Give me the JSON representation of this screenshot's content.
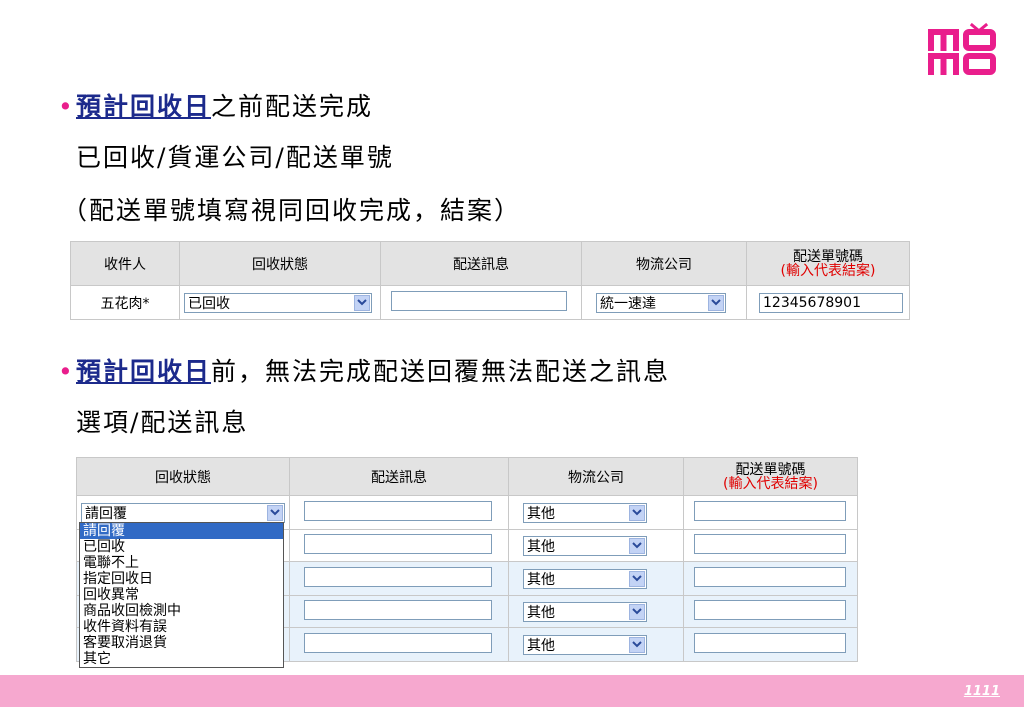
{
  "logo": {
    "text": "momo",
    "color": "#e91e8c"
  },
  "bullet1": {
    "highlight": "預計回收日",
    "rest": "之前配送完成",
    "line2": "已回收/貨運公司/配送單號",
    "line3": "（配送單號填寫視同回收完成，結案）"
  },
  "table1": {
    "headers": [
      "收件人",
      "回收狀態",
      "配送訊息",
      "物流公司"
    ],
    "header_last_main": "配送單號碼",
    "header_last_red": "(輸入代表結案)",
    "row": {
      "recipient": "五花肉*",
      "status": "已回收",
      "message": "",
      "logistics": "統一速達",
      "tracking": "12345678901"
    }
  },
  "bullet2": {
    "highlight": "預計回收日",
    "rest": "前，無法完成配送回覆無法配送之訊息",
    "line2": "選項/配送訊息"
  },
  "table2": {
    "headers": [
      "回收狀態",
      "配送訊息",
      "物流公司"
    ],
    "header_last_main": "配送單號碼",
    "header_last_red": "(輸入代表結案)",
    "first_status": "請回覆",
    "logistics": "其他"
  },
  "dropdown": {
    "options": [
      "請回覆",
      "已回收",
      "電聯不上",
      "指定回收日",
      "回收異常",
      "商品收回檢測中",
      "收件資料有誤",
      "客要取消退貨",
      "其它"
    ],
    "selected_index": 0
  },
  "footer": {
    "page": "1111"
  },
  "colors": {
    "accent": "#e91e8c",
    "highlight_text": "#1c2a8c",
    "footer_bg": "#f6a8cf",
    "header_red": "#e00000"
  }
}
